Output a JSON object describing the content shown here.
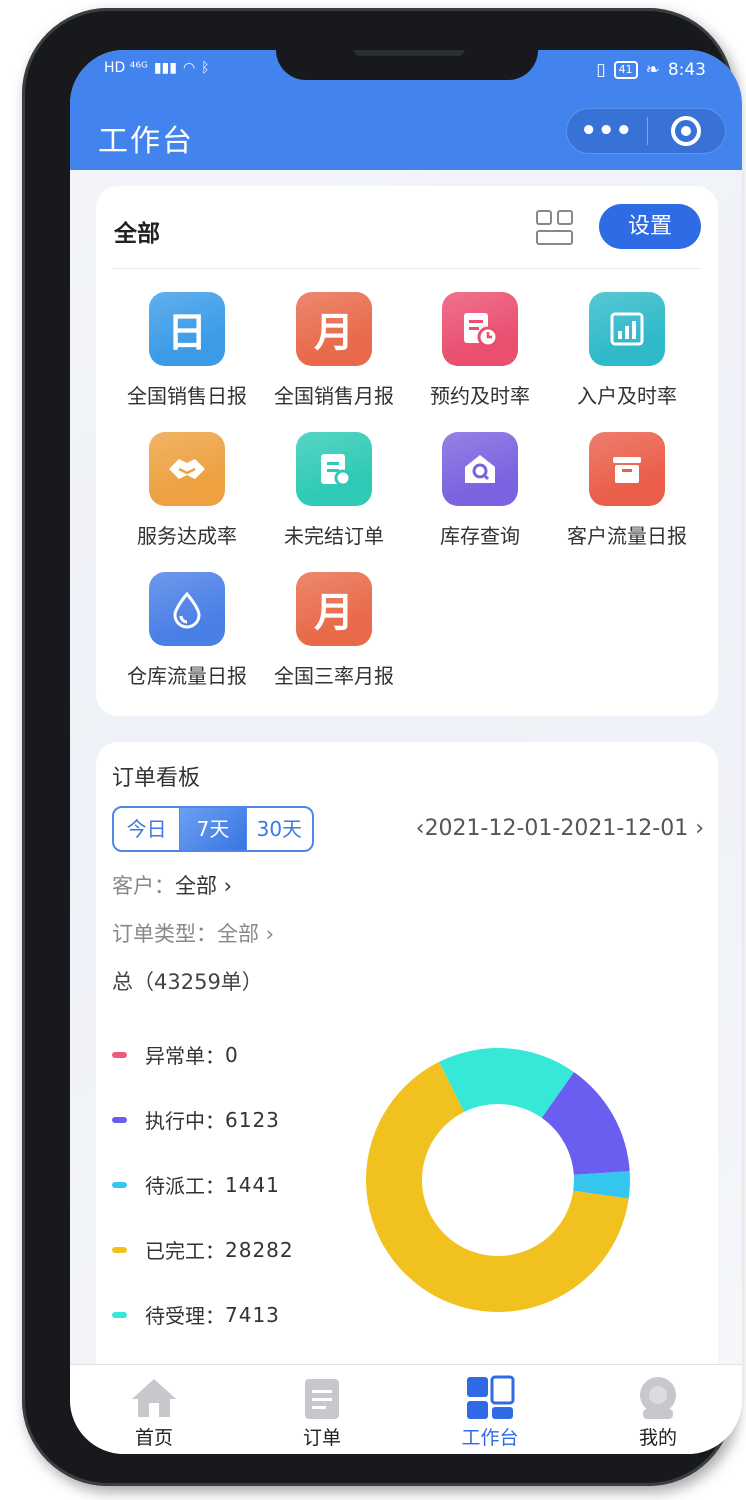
{
  "status_bar": {
    "left_indicators": "HD ⁴⁶ᴳ",
    "battery": "41",
    "time": "8:43"
  },
  "header": {
    "title": "工作台",
    "more_label": "•••"
  },
  "workbench": {
    "title": "全部",
    "settings_label": "设置",
    "apps": [
      {
        "label": "全国销售日报",
        "glyph": "日",
        "color": "#3b9be7"
      },
      {
        "label": "全国销售月报",
        "glyph": "月",
        "color": "#e86a4a"
      },
      {
        "label": "预约及时率",
        "glyph": "",
        "color": "#ea4f70"
      },
      {
        "label": "入户及时率",
        "glyph": "",
        "color": "#2fb9c9"
      },
      {
        "label": "服务达成率",
        "glyph": "",
        "color": "#eda140"
      },
      {
        "label": "未完结订单",
        "glyph": "",
        "color": "#2ecab5"
      },
      {
        "label": "库存查询",
        "glyph": "",
        "color": "#7b62e0"
      },
      {
        "label": "客户流量日报",
        "glyph": "",
        "color": "#ea5e4a"
      },
      {
        "label": "仓库流量日报",
        "glyph": "",
        "color": "#4a7fe6"
      },
      {
        "label": "全国三率月报",
        "glyph": "月",
        "color": "#e86a4a"
      }
    ]
  },
  "orders": {
    "title": "订单看板",
    "ranges": [
      "今日",
      "7天",
      "30天"
    ],
    "selected_range": "7天",
    "date_range": "‹2021-12-01-2021-12-01 ›",
    "customer_label": "客户：",
    "customer_value": "全部 ›",
    "type_label": "订单类型：",
    "type_value": "全部 ›",
    "total": "总（43259单）"
  },
  "chart_data": {
    "type": "pie",
    "donut": true,
    "categories": [
      "异常单",
      "执行中",
      "待派工",
      "已完工",
      "待受理"
    ],
    "values": [
      0,
      6123,
      1441,
      28282,
      7413
    ],
    "colors": [
      "#ea5a7a",
      "#6a5ef0",
      "#35c6ef",
      "#f1c21f",
      "#36e8d8"
    ],
    "legend_position": "left"
  },
  "tabbar": {
    "items": [
      {
        "label": "首页",
        "icon": "home-icon"
      },
      {
        "label": "订单",
        "icon": "clipboard-icon"
      },
      {
        "label": "工作台",
        "icon": "workbench-icon"
      },
      {
        "label": "我的",
        "icon": "profile-icon"
      }
    ],
    "active_index": 2
  }
}
